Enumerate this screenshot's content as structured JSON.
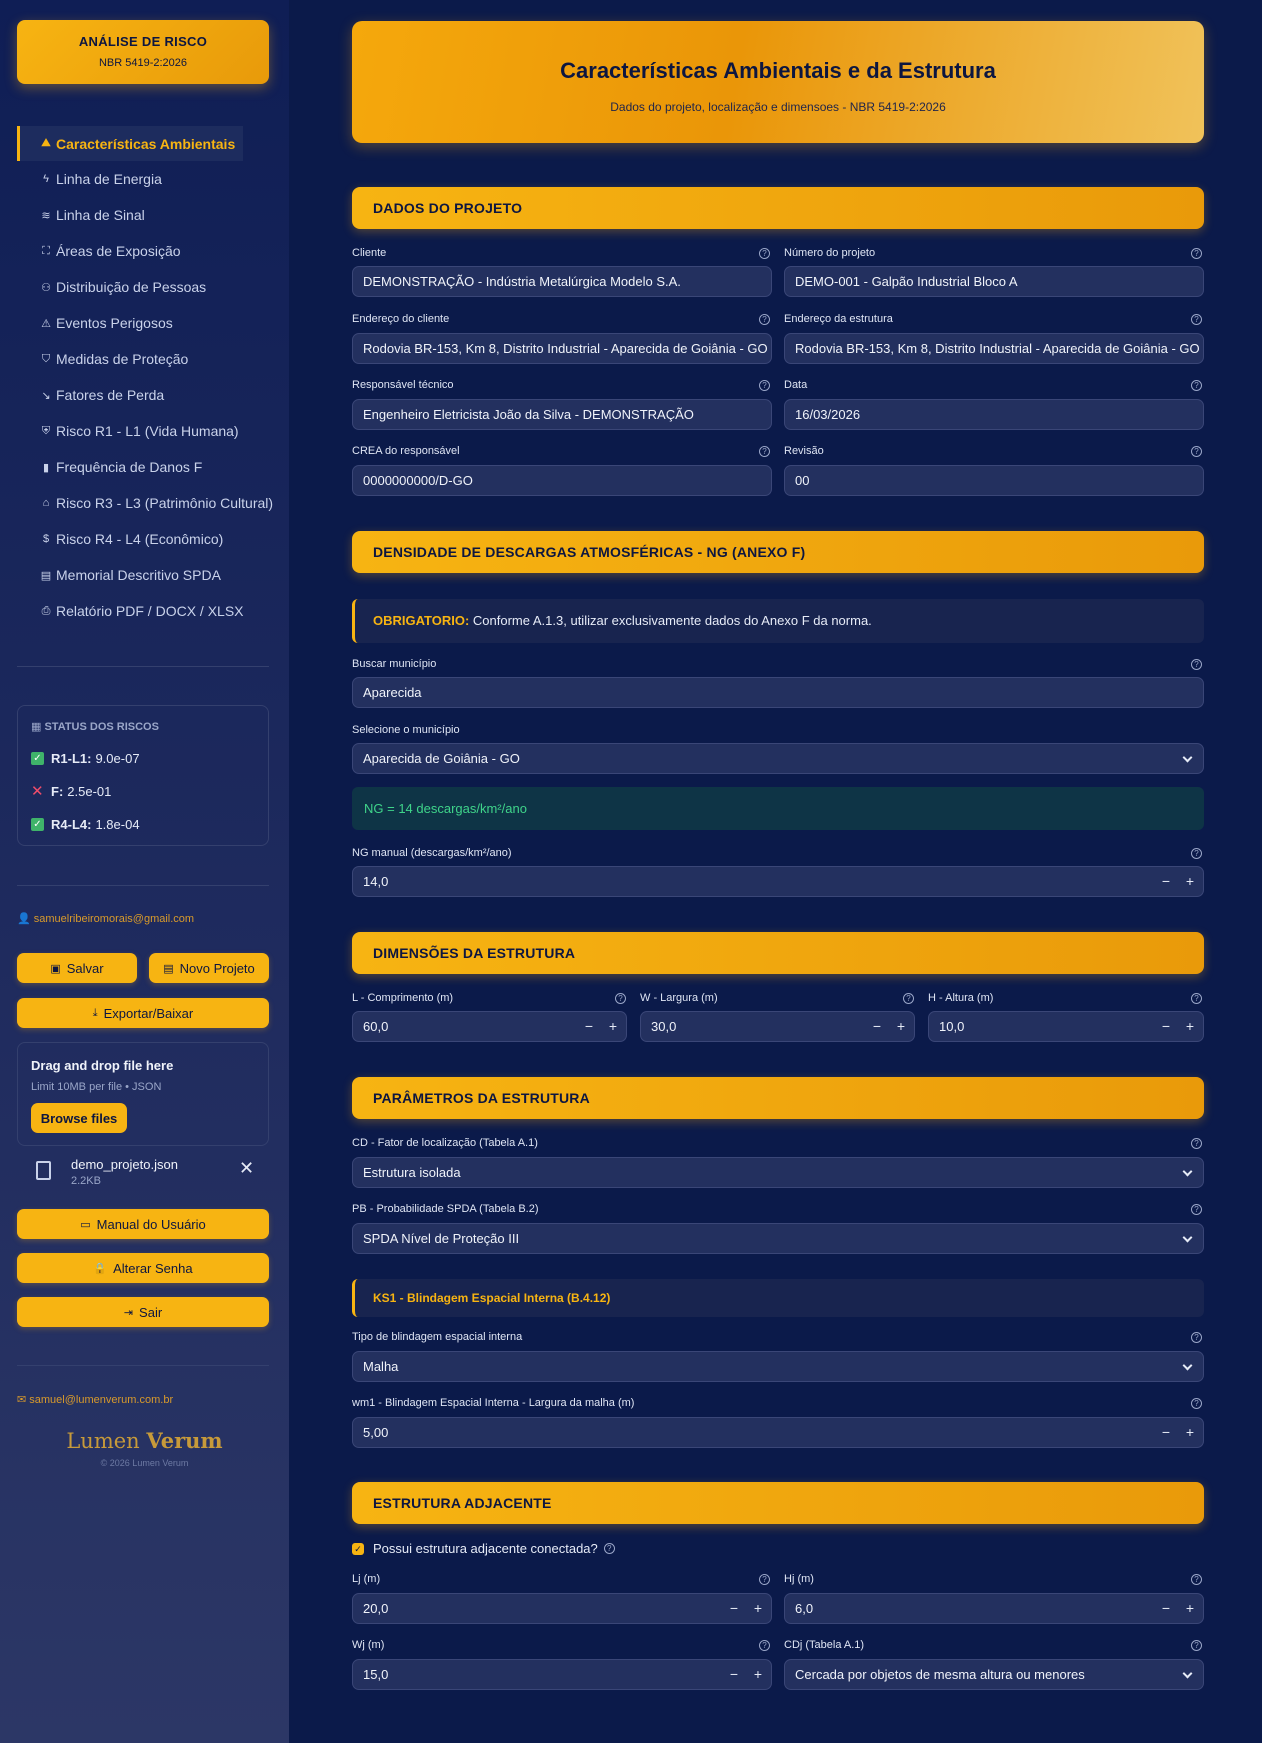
{
  "sidebar": {
    "brand_title": "ANÁLISE DE RISCO",
    "brand_sub": "NBR 5419-2:2026",
    "nav": [
      {
        "label": "Características Ambientais",
        "icon": "mountain-icon"
      },
      {
        "label": "Linha de Energia",
        "icon": "power-line-icon"
      },
      {
        "label": "Linha de Sinal",
        "icon": "signal-icon"
      },
      {
        "label": "Áreas de Exposição",
        "icon": "expand-icon"
      },
      {
        "label": "Distribuição de Pessoas",
        "icon": "people-icon"
      },
      {
        "label": "Eventos Perigosos",
        "icon": "warning-icon"
      },
      {
        "label": "Medidas de Proteção",
        "icon": "shield-icon"
      },
      {
        "label": "Fatores de Perda",
        "icon": "trend-down-icon"
      },
      {
        "label": "Risco R1 - L1 (Vida Humana)",
        "icon": "shield-person-icon"
      },
      {
        "label": "Frequência de Danos F",
        "icon": "bar-chart-icon"
      },
      {
        "label": "Risco R3 - L3 (Patrimônio Cultural)",
        "icon": "museum-icon"
      },
      {
        "label": "Risco R4 - L4 (Econômico)",
        "icon": "dollar-icon"
      },
      {
        "label": "Memorial Descritivo SPDA",
        "icon": "document-icon"
      },
      {
        "label": "Relatório PDF / DOCX / XLSX",
        "icon": "printer-icon"
      }
    ],
    "status": {
      "title": "STATUS DOS RISCOS",
      "rows": [
        {
          "key": "R1-L1:",
          "value": "9.0e-07",
          "ok": true
        },
        {
          "key": "F:",
          "value": "2.5e-01",
          "ok": false
        },
        {
          "key": "R4-L4:",
          "value": "1.8e-04",
          "ok": true
        }
      ]
    },
    "user_email": "samuelribeiromorais@gmail.com",
    "buttons": {
      "save": "Salvar",
      "new_project": "Novo Projeto",
      "export": "Exportar/Baixar",
      "manual": "Manual do Usuário",
      "change_password": "Alterar Senha",
      "logout": "Sair"
    },
    "upload": {
      "title": "Drag and drop file here",
      "sub": "Limit 10MB per file • JSON",
      "browse": "Browse files",
      "file_name": "demo_projeto.json",
      "file_size": "2.2KB"
    },
    "contact_email": "samuel@lumenverum.com.br",
    "logo_light": "Lumen ",
    "logo_bold": "Verum",
    "copyright": "© 2026 Lumen Verum"
  },
  "main": {
    "title": "Características Ambientais e da Estrutura",
    "subtitle": "Dados do projeto, localização e dimensoes - NBR 5419-2:2026",
    "sections": {
      "projeto": "DADOS DO PROJETO",
      "densidade": "DENSIDADE DE DESCARGAS ATMOSFÉRICAS - NG (ANEXO F)",
      "dimensoes": "DIMENSÕES DA ESTRUTURA",
      "parametros": "PARÂMETROS DA ESTRUTURA",
      "adjacente": "ESTRUTURA ADJACENTE"
    },
    "projeto": {
      "cliente_label": "Cliente",
      "cliente": "DEMONSTRAÇÃO - Indústria Metalúrgica Modelo S.A.",
      "numero_label": "Número do projeto",
      "numero": "DEMO-001 - Galpão Industrial Bloco A",
      "end_cliente_label": "Endereço do cliente",
      "end_cliente": "Rodovia BR-153, Km 8, Distrito Industrial - Aparecida de Goiânia - GO",
      "end_estrutura_label": "Endereço da estrutura",
      "end_estrutura": "Rodovia BR-153, Km 8, Distrito Industrial - Aparecida de Goiânia - GO",
      "resp_label": "Responsável técnico",
      "resp": "Engenheiro Eletricista João da Silva - DEMONSTRAÇÃO",
      "data_label": "Data",
      "data": "16/03/2026",
      "crea_label": "CREA do responsável",
      "crea": "0000000000/D-GO",
      "revisao_label": "Revisão",
      "revisao": "00"
    },
    "densidade": {
      "notice_strong": "OBRIGATORIO:",
      "notice_text": " Conforme A.1.3, utilizar exclusivamente dados do Anexo F da norma.",
      "buscar_label": "Buscar município",
      "buscar": "Aparecida",
      "selecione_label": "Selecione o município",
      "selecione": "Aparecida de Goiânia - GO",
      "ng_result": "NG = 14 descargas/km²/ano",
      "ng_manual_label": "NG manual (descargas/km²/ano)",
      "ng_manual": "14,0"
    },
    "dimensoes": {
      "l_label": "L - Comprimento (m)",
      "l": "60,0",
      "w_label": "W - Largura (m)",
      "w": "30,0",
      "h_label": "H - Altura (m)",
      "h": "10,0"
    },
    "parametros": {
      "cd_label": "CD - Fator de localização (Tabela A.1)",
      "cd": "Estrutura isolada",
      "pb_label": "PB - Probabilidade SPDA (Tabela B.2)",
      "pb": "SPDA Nível de Proteção III",
      "ks1_head": "KS1 - Blindagem Espacial Interna (B.4.12)",
      "tipo_label": "Tipo de blindagem espacial interna",
      "tipo": "Malha",
      "wm1_label": "wm1 - Blindagem Espacial Interna - Largura da malha (m)",
      "wm1": "5,00"
    },
    "adjacente": {
      "checkbox_label": "Possui estrutura adjacente conectada?",
      "checked": true,
      "lj_label": "Lj (m)",
      "lj": "20,0",
      "hj_label": "Hj (m)",
      "hj": "6,0",
      "wj_label": "Wj (m)",
      "wj": "15,0",
      "cdj_label": "CDj (Tabela A.1)",
      "cdj": "Cercada por objetos de mesma altura ou menores"
    }
  },
  "colors": {
    "accent": "#f7b412",
    "background": "#0b1a4a",
    "input": "#23305f",
    "success": "#3fd48a"
  }
}
